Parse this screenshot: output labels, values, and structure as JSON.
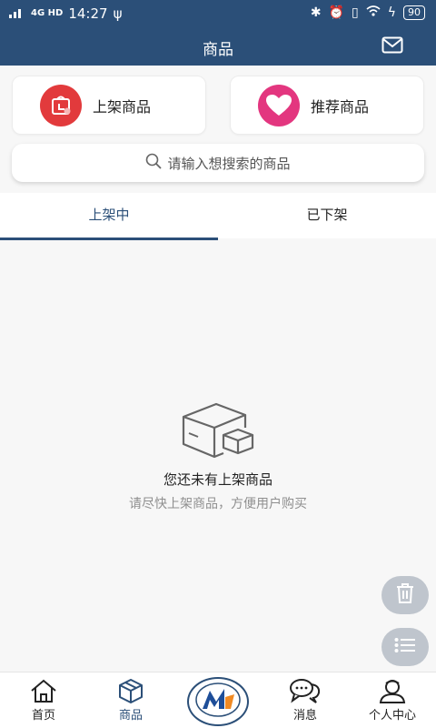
{
  "status_bar": {
    "signal": "4G HD",
    "time": "14:27",
    "battery": "90"
  },
  "header": {
    "title": "商品",
    "mail_icon": "mail-icon"
  },
  "actions": [
    {
      "label": "上架商品",
      "icon": "shelf-upload-icon",
      "color": "#e23a3c"
    },
    {
      "label": "推荐商品",
      "icon": "heart-icon",
      "color": "#e3367f"
    }
  ],
  "search": {
    "placeholder": "请输入想搜索的商品"
  },
  "tabs": [
    {
      "label": "上架中",
      "active": true
    },
    {
      "label": "已下架",
      "active": false
    }
  ],
  "empty_state": {
    "icon": "box-icon",
    "title": "您还未有上架商品",
    "subtitle": "请尽快上架商品，方便用户购买"
  },
  "floating_buttons": [
    {
      "icon": "trash-icon"
    },
    {
      "icon": "list-icon"
    }
  ],
  "bottom_nav": [
    {
      "label": "首页",
      "icon": "home-icon"
    },
    {
      "label": "商品",
      "icon": "product-box-icon",
      "active": true
    },
    {
      "label": "",
      "icon": "brand-logo-icon"
    },
    {
      "label": "消息",
      "icon": "chat-icon"
    },
    {
      "label": "个人中心",
      "icon": "user-icon"
    }
  ],
  "colors": {
    "primary": "#2b4f78",
    "red": "#e23a3c",
    "pink": "#e3367f"
  }
}
